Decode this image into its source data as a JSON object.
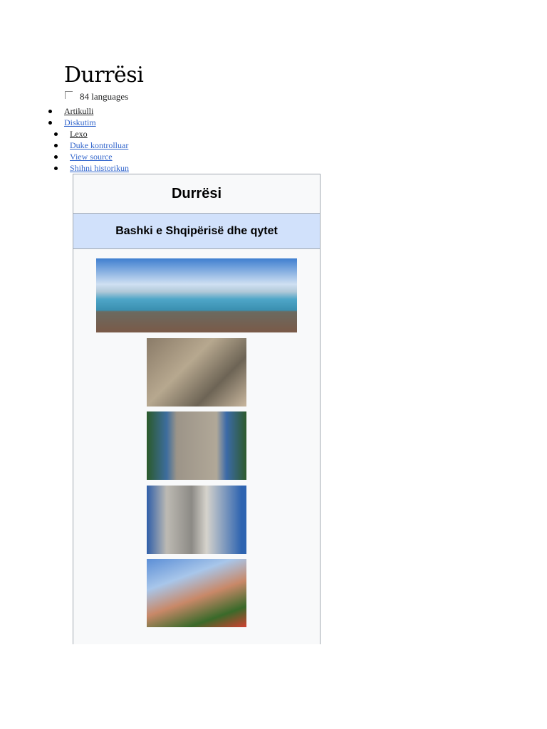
{
  "page": {
    "title": "Durrësi",
    "languages": "84 languages"
  },
  "tabs": [
    {
      "label": "Artikulli"
    },
    {
      "label": "Diskutim"
    }
  ],
  "actions": [
    {
      "label": "Lexo"
    },
    {
      "label": "Duke kontrolluar"
    },
    {
      "label": "View source"
    },
    {
      "label": "Shihni historikun"
    }
  ],
  "infobox": {
    "title": "Durrësi",
    "subtitle": "Bashki e Shqipërisë dhe qytet"
  }
}
